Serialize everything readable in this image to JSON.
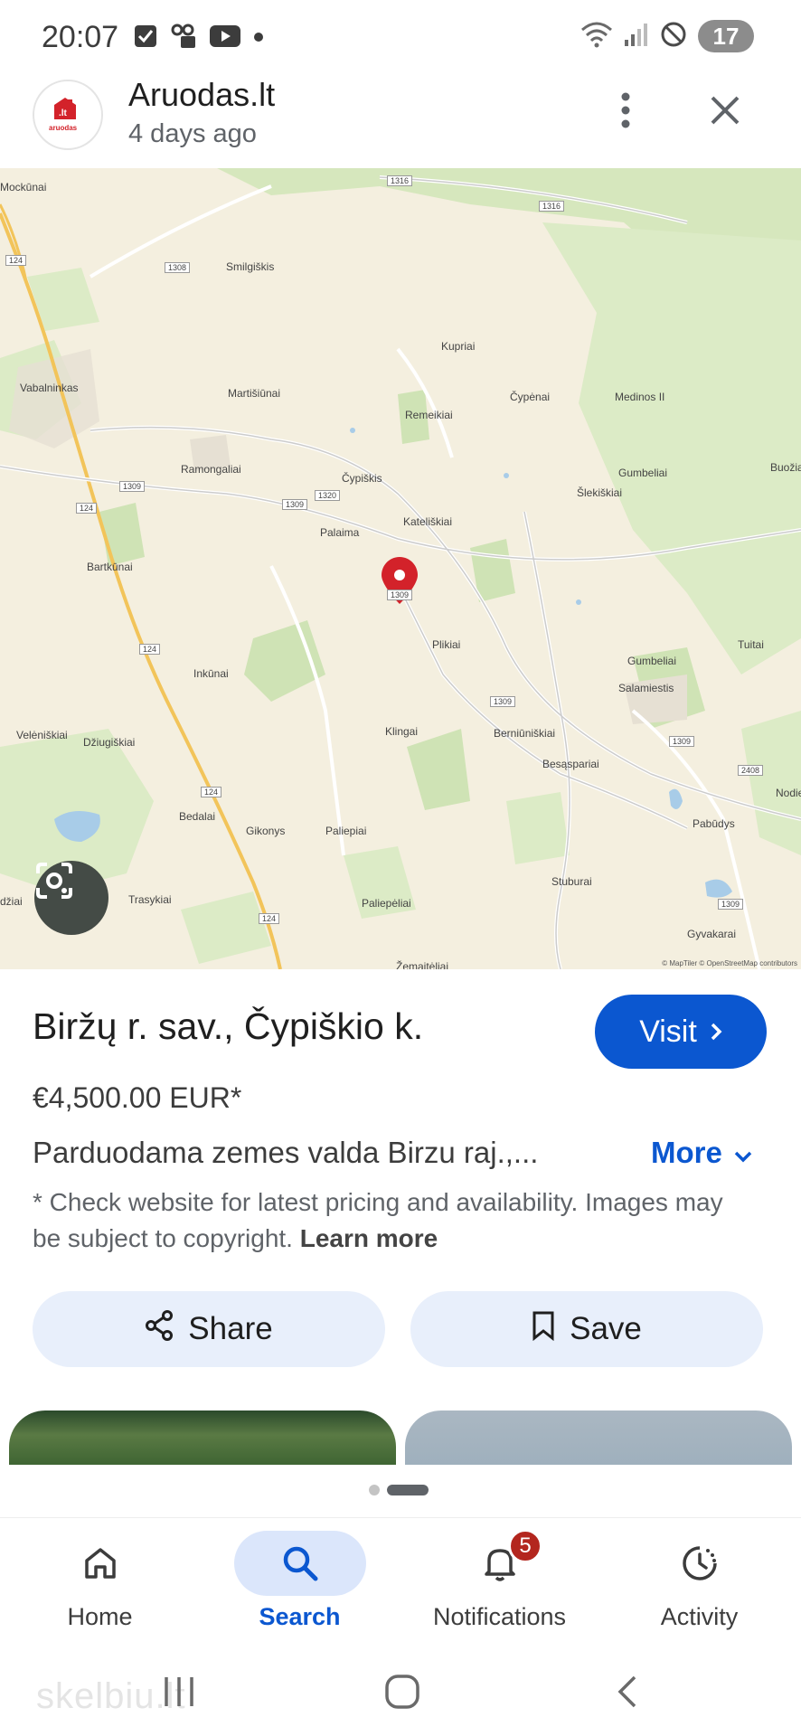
{
  "status_bar": {
    "time": "20:07",
    "battery": "17",
    "icons": [
      "check-icon",
      "voicemail-icon",
      "youtube-icon",
      "dot-icon",
      "wifi-icon",
      "signal-icon",
      "dnd-icon",
      "battery-icon"
    ]
  },
  "header": {
    "site_name": "Aruodas.lt",
    "time_ago": "4 days ago",
    "logo_text_top": ".lt",
    "logo_text_bottom": "aruodas"
  },
  "map": {
    "attribution": "© MapTiler © OpenStreetMap contributors",
    "places": [
      {
        "name": "Mockūnai"
      },
      {
        "name": "Smilgiškis"
      },
      {
        "name": "Kupriai"
      },
      {
        "name": "Vabalninkas"
      },
      {
        "name": "Martišiūnai"
      },
      {
        "name": "Remeikiai"
      },
      {
        "name": "Čypėnai"
      },
      {
        "name": "Medinos II"
      },
      {
        "name": "Ramongaliai"
      },
      {
        "name": "Čypiškis"
      },
      {
        "name": "Gumbeliai"
      },
      {
        "name": "Buožiai"
      },
      {
        "name": "Šlekiškiai"
      },
      {
        "name": "Kateliškiai"
      },
      {
        "name": "Palaima"
      },
      {
        "name": "Bartkūnai"
      },
      {
        "name": "Plikiai"
      },
      {
        "name": "Gumbeliai"
      },
      {
        "name": "Tuitai"
      },
      {
        "name": "Inkūnai"
      },
      {
        "name": "Salamiestis"
      },
      {
        "name": "Velėniškiai"
      },
      {
        "name": "Džiugiškiai"
      },
      {
        "name": "Klingai"
      },
      {
        "name": "Berniūniškiai"
      },
      {
        "name": "Besąspariai"
      },
      {
        "name": "Nodiе"
      },
      {
        "name": "Bedalai"
      },
      {
        "name": "Gikonys"
      },
      {
        "name": "Paliepiai"
      },
      {
        "name": "Pabūdys"
      },
      {
        "name": "Stuburai"
      },
      {
        "name": "Trasykiai"
      },
      {
        "name": "Paliepėliai"
      },
      {
        "name": "Gyvakarai"
      },
      {
        "name": "Žemaitėliai"
      },
      {
        "name": "džiai"
      }
    ],
    "road_numbers": [
      "1316",
      "1316",
      "1308",
      "124",
      "1309",
      "124",
      "1320",
      "1309",
      "1309",
      "124",
      "1309",
      "1309",
      "2408",
      "124",
      "124",
      "1309"
    ]
  },
  "listing": {
    "title": "Biržų r. sav., Čypiškio k.",
    "visit_label": "Visit",
    "price": "€4,500.00 EUR*",
    "description": "Parduodama zemes valda Birzu raj.,...",
    "more_label": "More",
    "disclaimer": "* Check website for latest pricing and availability. Images may be subject to copyright.",
    "learn_more": "Learn more",
    "share_label": "Share",
    "save_label": "Save"
  },
  "bottom_nav": {
    "items": [
      {
        "label": "Home",
        "icon": "home-icon"
      },
      {
        "label": "Search",
        "icon": "search-icon",
        "active": true
      },
      {
        "label": "Notifications",
        "icon": "bell-icon",
        "badge": "5"
      },
      {
        "label": "Activity",
        "icon": "activity-icon"
      }
    ]
  },
  "system_nav": {
    "watermark": "skelbiu.lt"
  },
  "colors": {
    "accent": "#0b57d0",
    "pill_bg": "#e8effb",
    "badge": "#b3261e",
    "map_bg": "#f4efdf",
    "map_green": "#cfe3b5",
    "pin": "#d3222a"
  }
}
